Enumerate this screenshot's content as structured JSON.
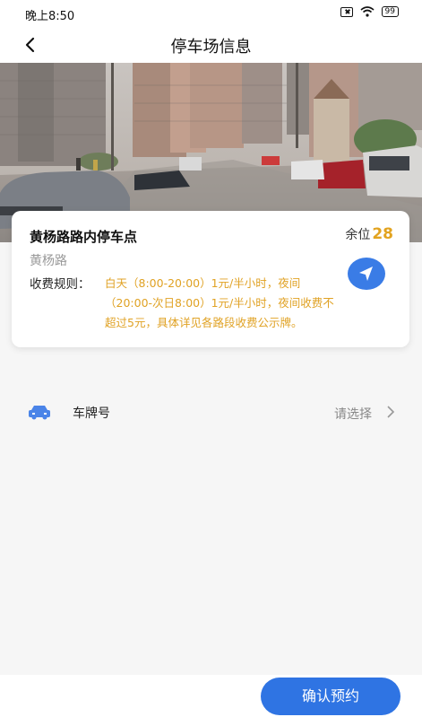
{
  "status_bar": {
    "time": "晚上8:50",
    "battery": "99"
  },
  "header": {
    "title": "停车场信息",
    "back_icon": "chevron-left-icon"
  },
  "parking": {
    "name": "黄杨路路内停车点",
    "remaining_label": "余位",
    "remaining_count": "28",
    "road": "黄杨路",
    "fee_label": "收费规则：",
    "fee_rule": "白天（8:00-20:00）1元/半小时，夜间（20:00-次日8:00）1元/半小时，夜间收费不超过5元，具体详见各路段收费公示牌。",
    "nav_icon": "navigation-arrow-icon",
    "accent_color": "#e2a31f"
  },
  "plate": {
    "label": "车牌号",
    "placeholder": "请选择",
    "icon": "car-icon"
  },
  "footer": {
    "confirm_label": "确认预约",
    "button_color": "#2f74e3"
  }
}
